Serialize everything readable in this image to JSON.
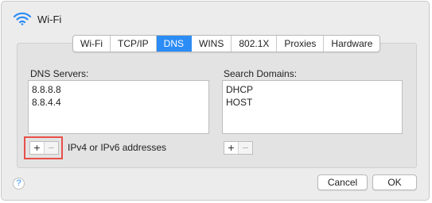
{
  "window": {
    "title": "Wi-Fi",
    "icon": "wifi-icon"
  },
  "tabs": [
    {
      "label": "Wi-Fi",
      "active": false
    },
    {
      "label": "TCP/IP",
      "active": false
    },
    {
      "label": "DNS",
      "active": true
    },
    {
      "label": "WINS",
      "active": false
    },
    {
      "label": "802.1X",
      "active": false
    },
    {
      "label": "Proxies",
      "active": false
    },
    {
      "label": "Hardware",
      "active": false
    }
  ],
  "dns_servers": {
    "label": "DNS Servers:",
    "items": [
      "8.8.8.8",
      "8.8.4.4"
    ],
    "hint": "IPv4 or IPv6 addresses"
  },
  "search_domains": {
    "label": "Search Domains:",
    "items": [
      "DHCP",
      "HOST"
    ]
  },
  "controls": {
    "add_symbol": "+",
    "remove_symbol": "−",
    "help_symbol": "?"
  },
  "footer": {
    "cancel_label": "Cancel",
    "ok_label": "OK"
  },
  "colors": {
    "accent": "#2b8cf5",
    "highlight": "#e8504a"
  }
}
